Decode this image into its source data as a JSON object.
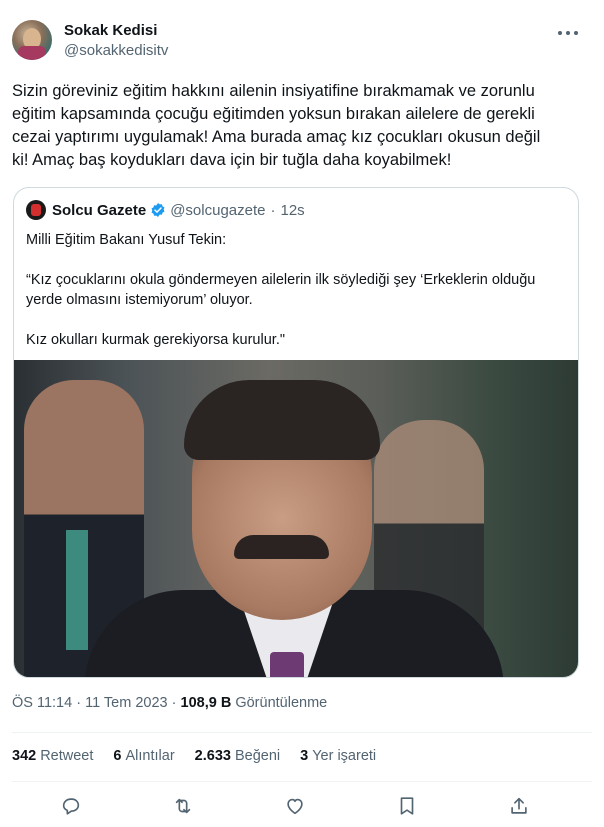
{
  "author": {
    "name": "Sokak Kedisi",
    "handle": "@sokakkedisitv"
  },
  "tweet": {
    "text": "Sizin göreviniz eğitim hakkını ailenin insiyatifine bırakmamak ve  zorunlu\neğitim kapsamında çocuğu eğitimden yoksun bırakan ailelere de  gerekli\ncezai  yaptırımı uygulamak! Ama burada amaç kız çocukları okusun değil\nki! Amaç baş koydukları dava için bir tuğla daha koyabilmek!"
  },
  "quote": {
    "name": "Solcu Gazete",
    "handle": "@solcugazete",
    "dot": "·",
    "time": "12s",
    "text": "Milli Eğitim Bakanı Yusuf Tekin:\n\n“Kız çocuklarını okula göndermeyen ailelerin ilk söylediği şey ‘Erkeklerin olduğu\nyerde olmasını istemiyorum’ oluyor.\n\nKız okulları kurmak gerekiyorsa kurulur.\""
  },
  "meta": {
    "time": "ÖS 11:14",
    "sep1": "·",
    "date": "11 Tem 2023",
    "sep2": "·",
    "views_count": "108,9 B",
    "views_label": "Görüntülenme"
  },
  "stats": {
    "retweets": {
      "count": "342",
      "label": "Retweet"
    },
    "quotes": {
      "count": "6",
      "label": "Alıntılar"
    },
    "likes": {
      "count": "2.633",
      "label": "Beğeni"
    },
    "bookmarks": {
      "count": "3",
      "label": "Yer işareti"
    }
  },
  "colors": {
    "text": "#0f1419",
    "secondary": "#536471",
    "border": "#cfd9de",
    "verified": "#1d9bf0"
  },
  "icons": [
    "more-icon",
    "verified-icon",
    "reply-icon",
    "retweet-icon",
    "like-icon",
    "bookmark-icon",
    "share-icon"
  ]
}
